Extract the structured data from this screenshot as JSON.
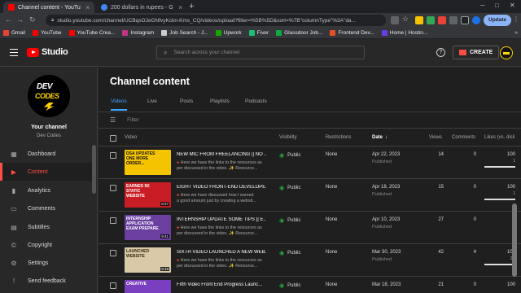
{
  "browser": {
    "tabs": [
      {
        "title": "Channel content - YouTu",
        "favicon_color": "#ff0000",
        "active": true
      },
      {
        "title": "200 dollars in rupees - G",
        "favicon_color": "#4285f4",
        "active": false
      }
    ],
    "new_tab": "+",
    "url": "studio.youtube.com/channel/UCBqsOJeGNfvyKckn-Kms_CQ/videos/upload?filter=%5B%5D&sort=%7B\"columnType\"%3A\"da...",
    "update_label": "Update",
    "bookmarks": [
      {
        "label": "Gmail",
        "color": "#ea4335"
      },
      {
        "label": "YouTube",
        "color": "#ff0000"
      },
      {
        "label": "YouTube Crea...",
        "color": "#ff0000"
      },
      {
        "label": "Instagram",
        "color": "#c13584"
      },
      {
        "label": "Job Search - J...",
        "color": "#cccccc"
      },
      {
        "label": "Upwork",
        "color": "#14a800"
      },
      {
        "label": "Fiver",
        "color": "#1dbf73"
      },
      {
        "label": "Glassdoor Job...",
        "color": "#0caa41"
      },
      {
        "label": "Frontend Dev...",
        "color": "#e34f26"
      },
      {
        "label": "Home | Hostin...",
        "color": "#673de6"
      }
    ],
    "bookmarks_more": "»"
  },
  "header": {
    "studio_label": "Studio",
    "search_placeholder": "Search across your channel",
    "help_label": "?",
    "create_label": "CREATE"
  },
  "sidebar": {
    "avatar_line1": "DEV",
    "avatar_line2": "CODES",
    "your_channel": "Your channel",
    "channel_name": "Dev Codes",
    "items": [
      {
        "label": "Dashboard",
        "icon": "dashboard-icon",
        "glyph": "▦",
        "active": false
      },
      {
        "label": "Content",
        "icon": "content-icon",
        "glyph": "▶",
        "active": true
      },
      {
        "label": "Analytics",
        "icon": "analytics-icon",
        "glyph": "▮",
        "active": false
      },
      {
        "label": "Comments",
        "icon": "comments-icon",
        "glyph": "▭",
        "active": false
      },
      {
        "label": "Subtitles",
        "icon": "subtitles-icon",
        "glyph": "▤",
        "active": false
      },
      {
        "label": "Copyright",
        "icon": "copyright-icon",
        "glyph": "©",
        "active": false
      },
      {
        "label": "Settings",
        "icon": "settings-icon",
        "glyph": "⚙",
        "active": false
      },
      {
        "label": "Send feedback",
        "icon": "feedback-icon",
        "glyph": "!",
        "active": false
      }
    ]
  },
  "main": {
    "title": "Channel content",
    "tabs": [
      "Videos",
      "Live",
      "Posts",
      "Playlists",
      "Podcasts"
    ],
    "filter_placeholder": "Filter",
    "columns": {
      "video": "Video",
      "visibility": "Visibility",
      "restrictions": "Restrictions",
      "date": "Date",
      "views": "Views",
      "comments": "Comments",
      "likes": "Likes (vs. disli"
    },
    "rows": [
      {
        "thumb_text": "DSA UPDATES ONE MORE ORDER...",
        "thumb_bg": "#f5c400",
        "thumb_fg": "#111111",
        "duration": "",
        "title": "NEW MIC FROM FREELANCING || NO ...",
        "desc_line1": "Here we have the links to the resources as",
        "desc_line2": "per discussed in the video. ✨ Resource...",
        "visibility": "Public",
        "restrictions": "None",
        "date": "Apr 22, 2023",
        "status": "Published",
        "views": "14",
        "comments": "0",
        "likes": "100",
        "likes_sub": "1",
        "likes_fraction": 1.0
      },
      {
        "thumb_text": "EARNED 5K STATIC WEBSITE",
        "thumb_bg": "#c81d25",
        "thumb_fg": "#ffffff",
        "duration": "8:27",
        "title": "EIGHT VIDEO FRONT-END DEVELOPE...",
        "desc_line1": "Here we have discussed how I earned",
        "desc_line2": "a good amount just by creating a websit...",
        "visibility": "Public",
        "restrictions": "None",
        "date": "Apr 18, 2023",
        "status": "Published",
        "views": "15",
        "comments": "0",
        "likes": "100",
        "likes_sub": "1",
        "likes_fraction": 1.0
      },
      {
        "thumb_text": "INTERNSHIP APPLICATION EXAM PREPARE",
        "thumb_bg": "#6a3fa0",
        "thumb_fg": "#ffffff",
        "duration": "9:41",
        "title": "INTERNSHIP UPDATE SOME TIPS || E...",
        "desc_line1": "Here we have the links to the resources as",
        "desc_line2": "per discussed in the video. ✨ Resource...",
        "visibility": "Public",
        "restrictions": "None",
        "date": "Apr 10, 2023",
        "status": "Published",
        "views": "27",
        "comments": "0",
        "likes": "",
        "likes_sub": "",
        "likes_fraction": 0
      },
      {
        "thumb_text": "LAUNCHED WEBSITE",
        "thumb_bg": "#d9c9a8",
        "thumb_fg": "#3a2a10",
        "duration": "8:49",
        "title": "SIXTH VIDEO LAUNCHED A NEW WEB...",
        "desc_line1": "Here we have the links to the resources as",
        "desc_line2": "per discussed in the video. ✨ Resource...",
        "visibility": "Public",
        "restrictions": "None",
        "date": "Mar 30, 2023",
        "status": "Published",
        "views": "42",
        "comments": "4",
        "likes": "100",
        "likes_sub": "2 li",
        "likes_fraction": 1.0
      },
      {
        "thumb_text": "CREATIVE",
        "thumb_bg": "#7a3fc0",
        "thumb_fg": "#ffffff",
        "duration": "",
        "title": "Fifth Video Front End Progress Launc...",
        "desc_line1": "",
        "desc_line2": "",
        "visibility": "Public",
        "restrictions": "None",
        "date": "Mar 18, 2023",
        "status": "",
        "views": "21",
        "comments": "0",
        "likes": "100",
        "likes_sub": "",
        "likes_fraction": 1.0
      }
    ]
  }
}
